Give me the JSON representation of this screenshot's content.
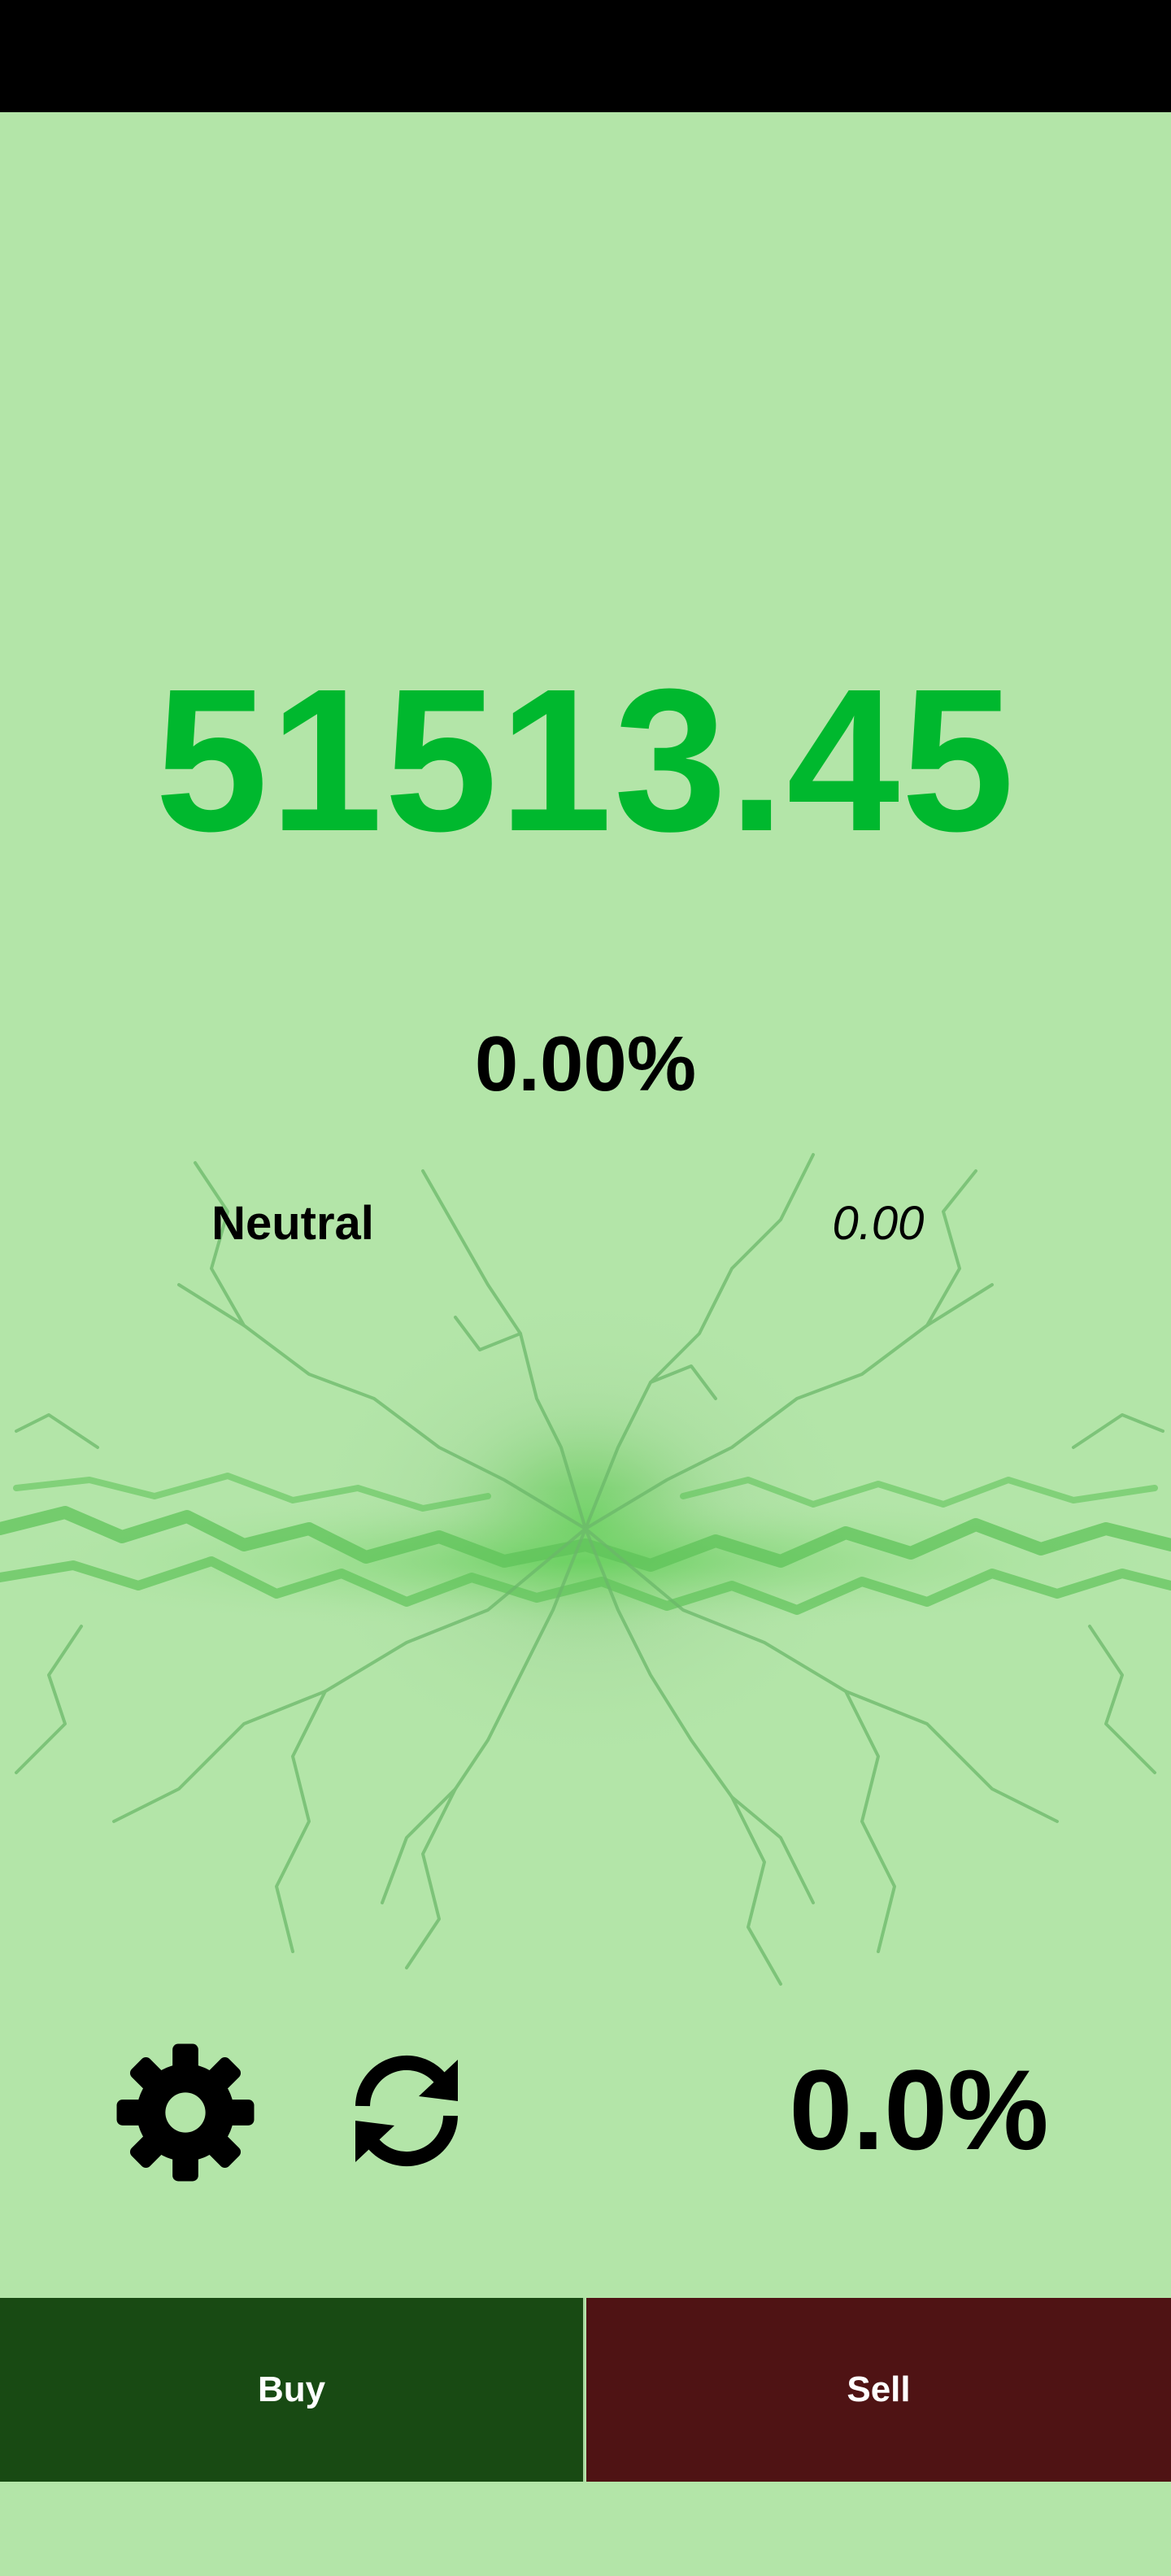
{
  "ticker": {
    "price": "51513.45",
    "change_percent": "0.00%"
  },
  "sentiment": {
    "label": "Neutral",
    "value": "0.00"
  },
  "controls": {
    "settings_icon": "gear-icon",
    "refresh_icon": "refresh-icon",
    "percent": "0.0%"
  },
  "actions": {
    "buy_label": "Buy",
    "sell_label": "Sell"
  },
  "colors": {
    "background": "#b3e5a8",
    "price": "#00b82e",
    "buy": "#184a13",
    "sell": "#4f1314",
    "status_bar": "#000000"
  }
}
